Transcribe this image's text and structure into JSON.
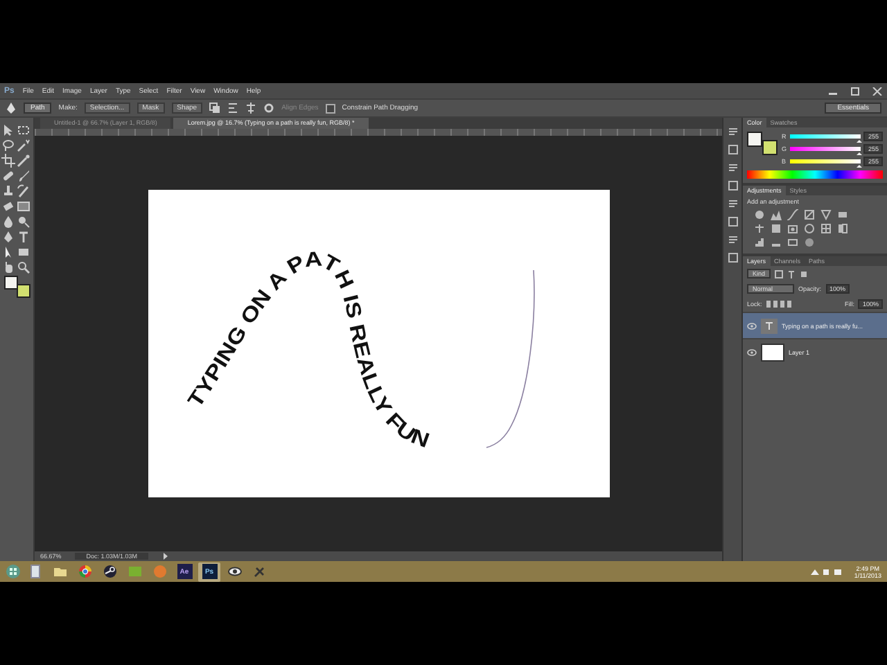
{
  "app": {
    "logo": "Ps"
  },
  "menu": [
    "File",
    "Edit",
    "Image",
    "Layer",
    "Type",
    "Select",
    "Filter",
    "View",
    "Window",
    "Help"
  ],
  "options_bar": {
    "mode": "Path",
    "make_label": "Make:",
    "make_buttons": [
      "Selection...",
      "Mask",
      "Shape"
    ],
    "align_label": "Align Edges",
    "constrain": {
      "label": "Constrain Path Dragging",
      "checked": false
    }
  },
  "workspace": "Essentials",
  "tabs": [
    {
      "label": "Untitled-1 @ 66.7% (Layer 1, RGB/8)",
      "selected": false
    },
    {
      "label": "Lorem.jpg @ 16.7% (Typing on a path is really fun, RGB/8) *",
      "selected": true
    }
  ],
  "canvas": {
    "text": "TYPING ON A PATH IS REALLY FUN"
  },
  "status_bar": {
    "zoom": "66.67%",
    "info": "Doc: 1.03M/1.03M"
  },
  "tool_colors": [
    {
      "kind": "foreground",
      "color": "#f4f4f0"
    },
    {
      "kind": "background",
      "color": "#d2e070"
    }
  ],
  "color_panel": {
    "tabs": [
      {
        "label": "Color",
        "selected": true
      },
      {
        "label": "Swatches",
        "selected": false
      }
    ],
    "channels": [
      {
        "name": "R",
        "level": 0.97,
        "value": "255"
      },
      {
        "name": "G",
        "level": 0.97,
        "value": "255"
      },
      {
        "name": "B",
        "level": 0.97,
        "value": "255"
      }
    ]
  },
  "adjustments_panel": {
    "tabs": [
      {
        "label": "Adjustments",
        "selected": true
      },
      {
        "label": "Styles",
        "selected": false
      }
    ],
    "hint": "Add an adjustment"
  },
  "layers_panel": {
    "tabs": [
      {
        "label": "Layers",
        "selected": true
      },
      {
        "label": "Channels",
        "selected": false
      },
      {
        "label": "Paths",
        "selected": false
      }
    ],
    "filter": "Kind",
    "blend_mode": "Normal",
    "opacity_label": "Opacity:",
    "opacity": "100%",
    "lock_label": "Lock:",
    "fill_label": "Fill:",
    "fill": "100%",
    "layers": [
      {
        "kind": "text",
        "name": "Typing on a path is really fu...",
        "selected": true,
        "visible": true
      },
      {
        "kind": "image",
        "name": "Layer 1",
        "selected": false,
        "visible": true
      }
    ]
  },
  "taskbar": {
    "apps": [
      {
        "kind": "file",
        "active": false
      },
      {
        "kind": "folder",
        "active": false
      },
      {
        "kind": "browser",
        "active": false
      },
      {
        "kind": "steam",
        "active": false
      },
      {
        "kind": "green",
        "active": false
      },
      {
        "kind": "orange",
        "active": false
      },
      {
        "kind": "ae",
        "label": "Ae",
        "active": false
      },
      {
        "kind": "ps",
        "label": "Ps",
        "active": true
      },
      {
        "kind": "eye",
        "active": false
      },
      {
        "kind": "tools",
        "active": false
      }
    ],
    "clock": {
      "time": "2:49 PM",
      "date": "1/11/2013"
    }
  }
}
